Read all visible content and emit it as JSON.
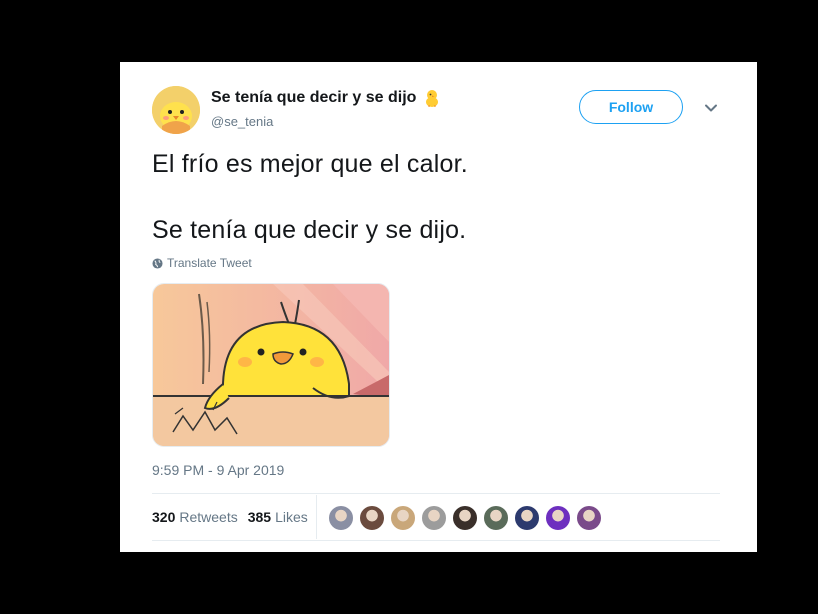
{
  "author": {
    "name": "Se tenía que decir y se dijo",
    "handle": "@se_tenia"
  },
  "follow_label": "Follow",
  "tweet": {
    "line1": "El frío es mejor que el calor.",
    "line2": "Se tenía que decir y se dijo."
  },
  "translate_label": "Translate Tweet",
  "timestamp": "9:59 PM - 9 Apr 2019",
  "stats": {
    "retweets_count": "320",
    "retweets_label": "Retweets",
    "likes_count": "385",
    "likes_label": "Likes"
  },
  "likers": [
    {
      "color": "#8a8fa3"
    },
    {
      "color": "#6b4b3e"
    },
    {
      "color": "#c9a77a"
    },
    {
      "color": "#9c9c9c"
    },
    {
      "color": "#3a2f2a"
    },
    {
      "color": "#5a6b5a"
    },
    {
      "color": "#2c3a6e"
    },
    {
      "color": "#6d2fbf"
    },
    {
      "color": "#7a4a8a"
    }
  ],
  "colors": {
    "accent": "#1da1f2",
    "secondary_text": "#657786",
    "primary_text": "#14171a"
  },
  "icons": [
    "chick-emoji-icon",
    "chevron-down-icon",
    "globe-icon"
  ]
}
